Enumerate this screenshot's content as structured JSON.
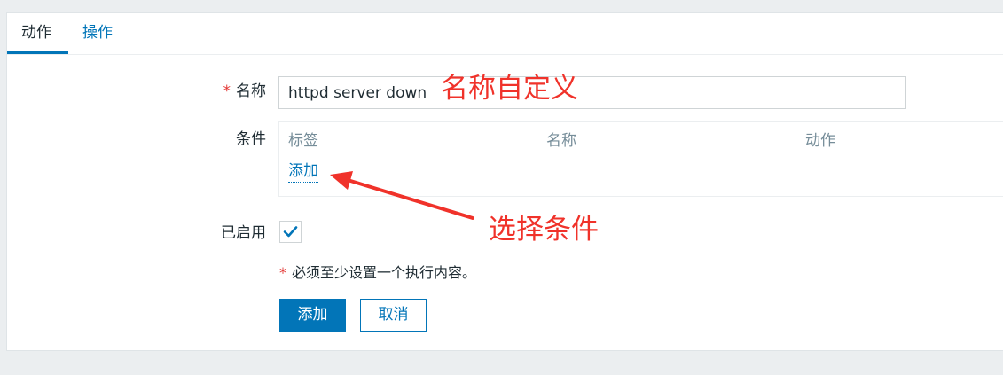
{
  "tabs": [
    {
      "label": "动作",
      "active": true
    },
    {
      "label": "操作",
      "active": false
    }
  ],
  "form": {
    "name_label": "名称",
    "name_required_mark": "*",
    "name_value": "httpd server down",
    "conditions_label": "条件",
    "conditions_columns": [
      "标签",
      "名称",
      "动作"
    ],
    "conditions_add_link": "添加",
    "enabled_label": "已启用",
    "enabled_checked": true,
    "required_note_mark": "*",
    "required_note": "必须至少设置一个执行内容。",
    "add_button": "添加",
    "cancel_button": "取消"
  },
  "annotations": {
    "name_custom": "名称自定义",
    "choose_condition": "选择条件"
  },
  "colors": {
    "accent": "#0275b8",
    "required": "#e33734",
    "annotation": "#f0322a",
    "muted_header": "#768d99"
  },
  "icons": {
    "checkbox": "checkmark-icon",
    "annotation_arrow": "red-arrow-icon"
  }
}
